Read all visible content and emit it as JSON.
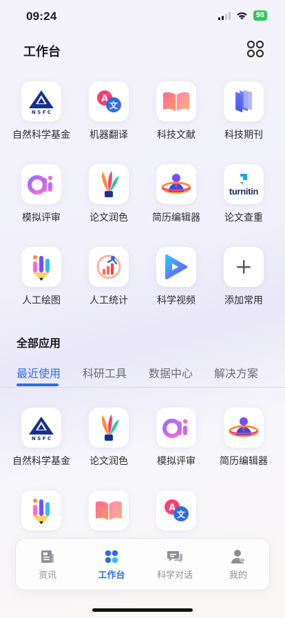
{
  "status_bar": {
    "time": "09:24",
    "battery": "98"
  },
  "header": {
    "title": "工作台"
  },
  "favorites": [
    {
      "label": "自然科学基金",
      "icon": "nsfc-logo-icon"
    },
    {
      "label": "机器翻译",
      "icon": "translate-icon"
    },
    {
      "label": "科技文献",
      "icon": "open-book-icon"
    },
    {
      "label": "科技期刊",
      "icon": "journal-icon"
    },
    {
      "label": "模拟评审",
      "icon": "ai-logo-icon"
    },
    {
      "label": "论文润色",
      "icon": "quill-pen-icon"
    },
    {
      "label": "简历编辑器",
      "icon": "resume-person-icon"
    },
    {
      "label": "论文查重",
      "icon": "turnitin-logo-icon",
      "logo_text": "turnitin"
    },
    {
      "label": "人工绘图",
      "icon": "pencil-chart-icon"
    },
    {
      "label": "人工统计",
      "icon": "statistics-runner-icon"
    },
    {
      "label": "科学视频",
      "icon": "video-play-icon"
    },
    {
      "label": "添加常用",
      "icon": "plus-icon"
    }
  ],
  "all_apps": {
    "title": "全部应用"
  },
  "tabs": [
    {
      "label": "最近使用",
      "active": true
    },
    {
      "label": "科研工具",
      "active": false
    },
    {
      "label": "数据中心",
      "active": false
    },
    {
      "label": "解决方案",
      "active": false
    }
  ],
  "recent": [
    {
      "label": "自然科学基金",
      "icon": "nsfc-logo-icon"
    },
    {
      "label": "论文润色",
      "icon": "quill-pen-icon"
    },
    {
      "label": "模拟评审",
      "icon": "ai-logo-icon"
    },
    {
      "label": "简历编辑器",
      "icon": "resume-person-icon"
    },
    {
      "label": "",
      "icon": "pencil-chart-icon"
    },
    {
      "label": "",
      "icon": "open-book-icon"
    },
    {
      "label": "",
      "icon": "translate-icon"
    }
  ],
  "bottom_nav": [
    {
      "label": "资讯",
      "icon": "news-icon",
      "active": false
    },
    {
      "label": "工作台",
      "icon": "workbench-icon",
      "active": true
    },
    {
      "label": "科学对话",
      "icon": "chat-icon",
      "active": false
    },
    {
      "label": "我的",
      "icon": "profile-icon",
      "active": false
    }
  ],
  "colors": {
    "accent": "#2f6de1",
    "nsfc_blue": "#1b2f8f"
  }
}
